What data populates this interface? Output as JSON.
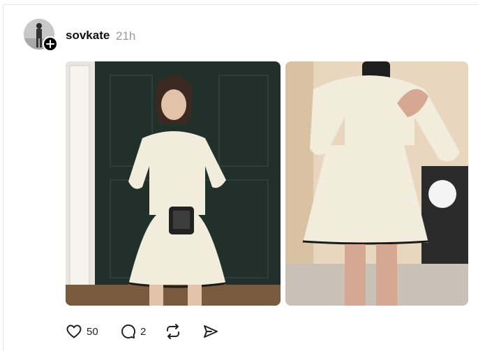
{
  "post": {
    "username": "sovkate",
    "timestamp": "21h",
    "likes": "50",
    "comments": "2"
  },
  "icons": {
    "like": "heart-icon",
    "comment": "comment-bubble-icon",
    "repost": "repost-icon",
    "share": "share-send-icon",
    "follow": "plus-icon"
  },
  "colors": {
    "text": "#101010",
    "muted": "#9a9a9a",
    "border": "#e6e6e6"
  }
}
